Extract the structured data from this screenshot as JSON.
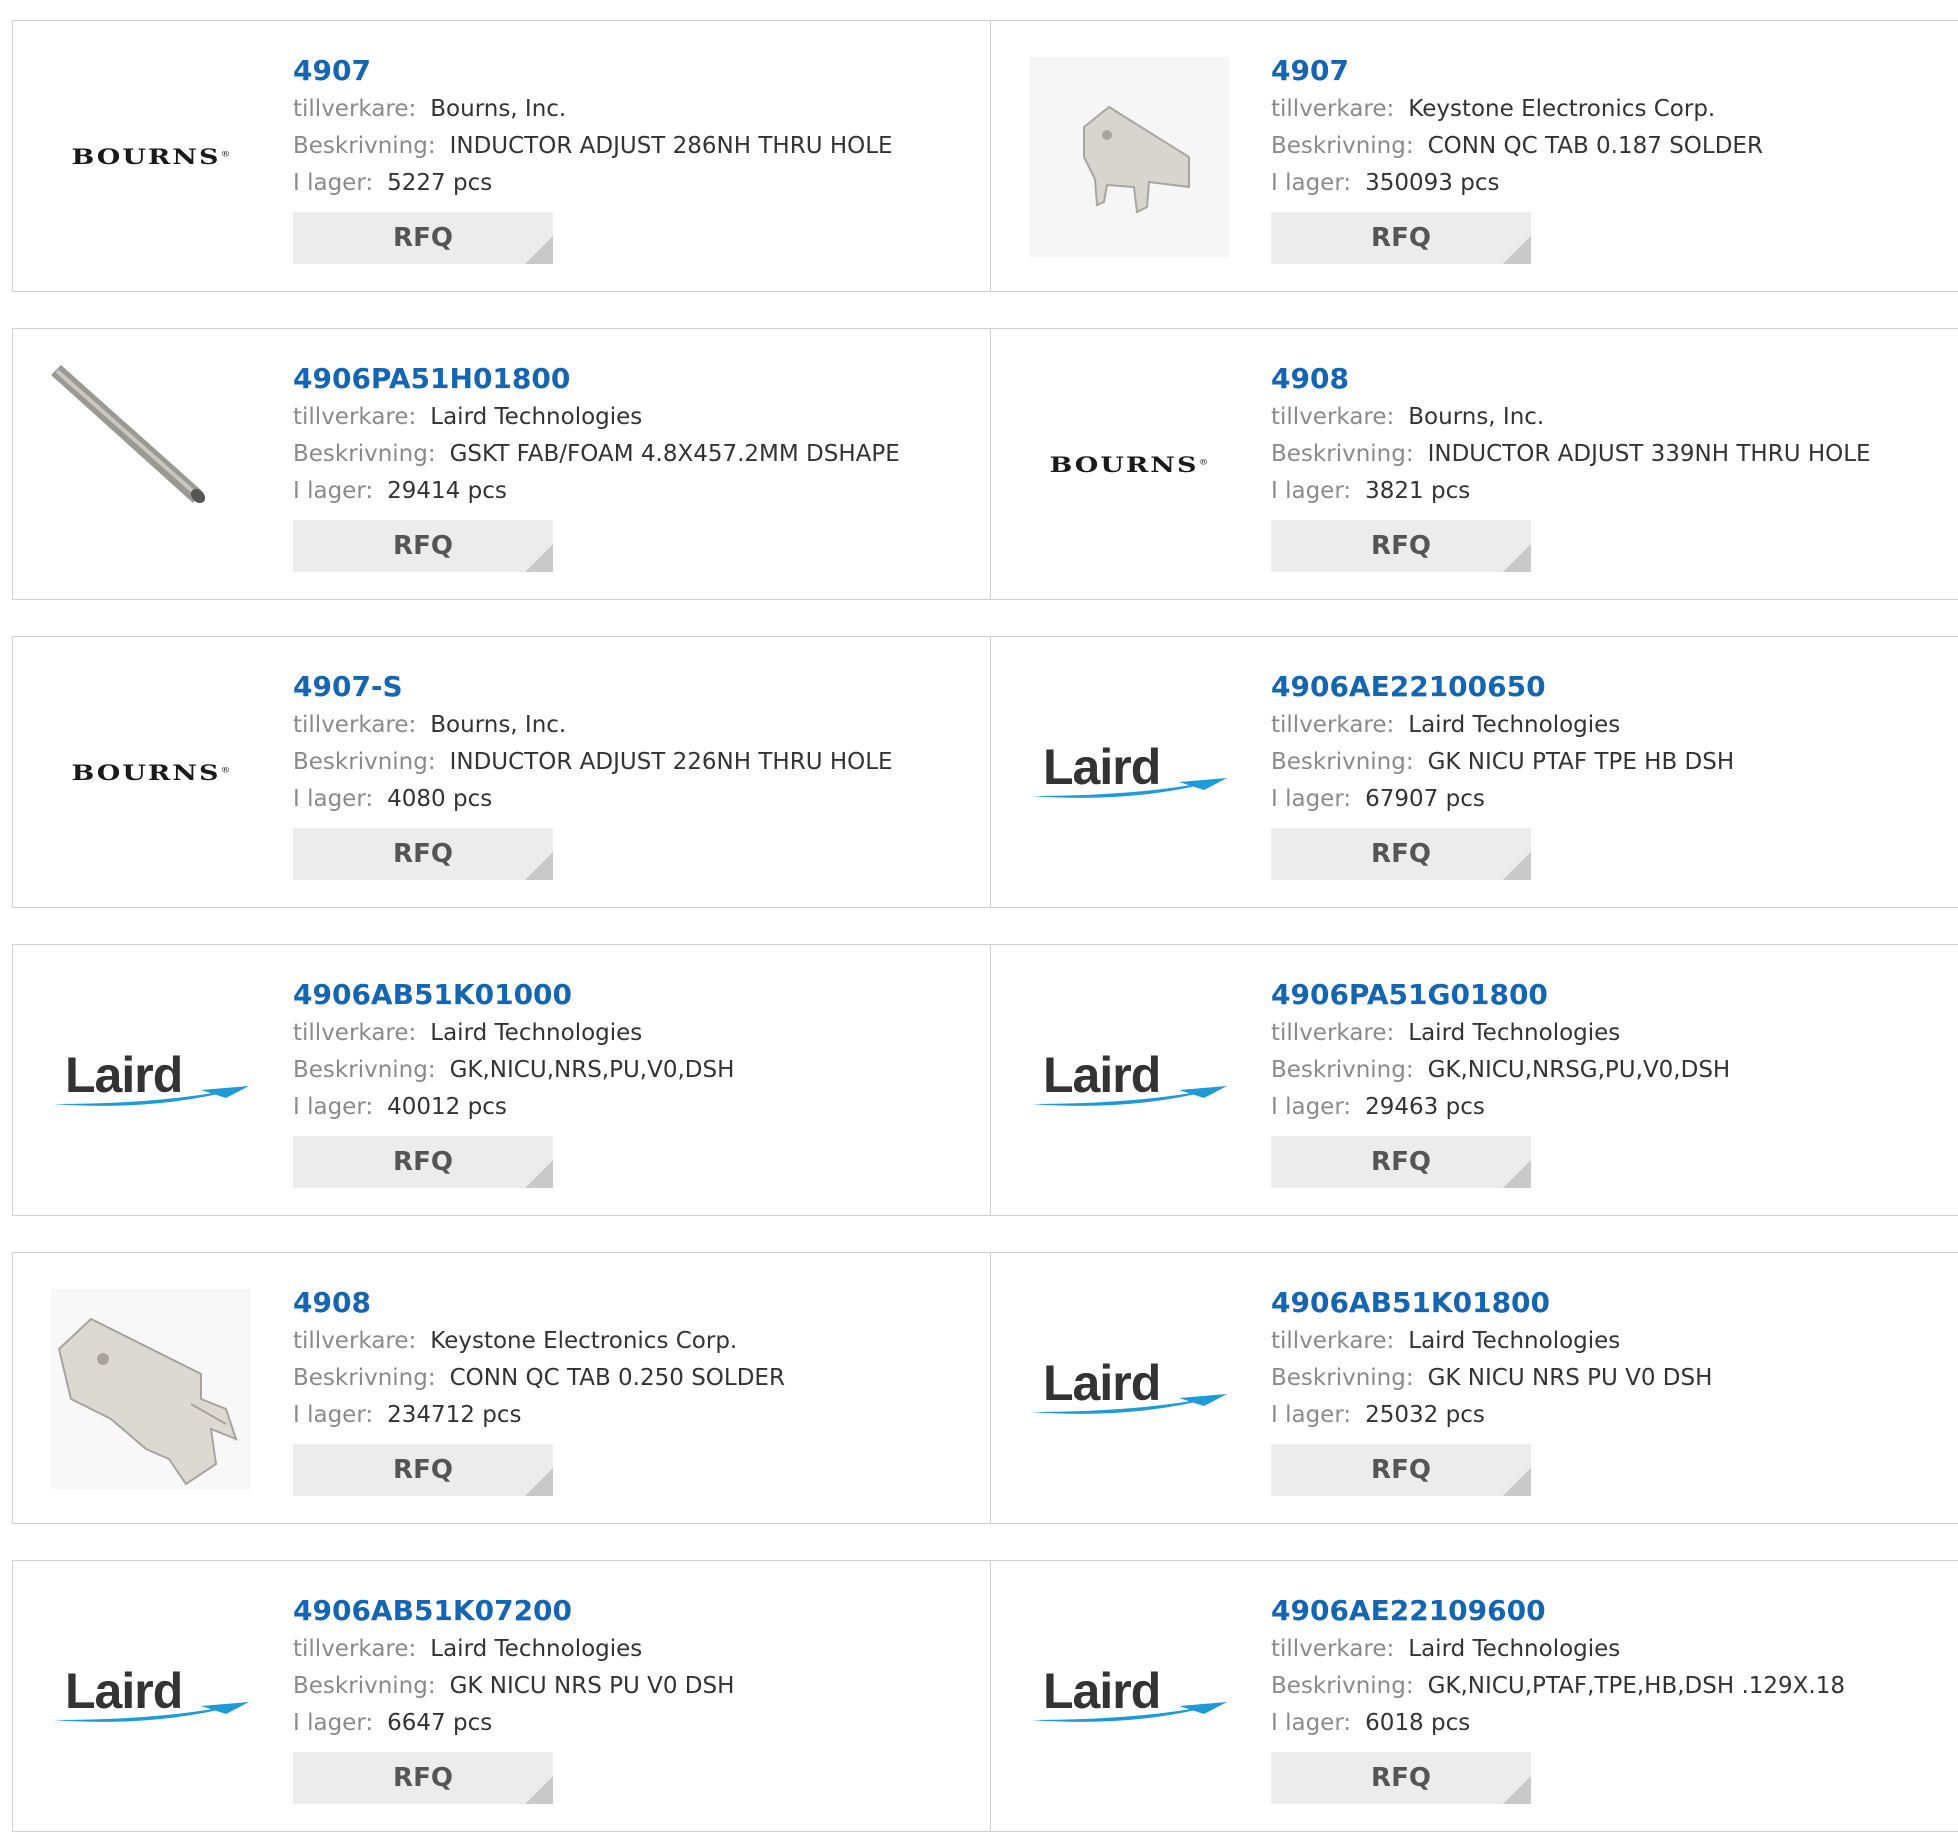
{
  "labels": {
    "manufacturer": "tillverkare:",
    "description": "Beskrivning:",
    "stock": "I lager:",
    "rfq": "RFQ"
  },
  "logos": {
    "bourns": "BOURNS",
    "laird": "Laird"
  },
  "products": [
    {
      "part": "4907",
      "manufacturer": "Bourns, Inc.",
      "description": "INDUCTOR ADJUST 286NH THRU HOLE",
      "stock": "5227 pcs",
      "image": "bourns-logo"
    },
    {
      "part": "4907",
      "manufacturer": "Keystone Electronics Corp.",
      "description": "CONN QC TAB 0.187 SOLDER",
      "stock": "350093 pcs",
      "image": "qc-tab-photo"
    },
    {
      "part": "4906PA51H01800",
      "manufacturer": "Laird Technologies",
      "description": "GSKT FAB/FOAM 4.8X457.2MM DSHAPE",
      "stock": "29414 pcs",
      "image": "gasket-photo"
    },
    {
      "part": "4908",
      "manufacturer": "Bourns, Inc.",
      "description": "INDUCTOR ADJUST 339NH THRU HOLE",
      "stock": "3821 pcs",
      "image": "bourns-logo"
    },
    {
      "part": "4907-S",
      "manufacturer": "Bourns, Inc.",
      "description": "INDUCTOR ADJUST 226NH THRU HOLE",
      "stock": "4080 pcs",
      "image": "bourns-logo"
    },
    {
      "part": "4906AE22100650",
      "manufacturer": "Laird Technologies",
      "description": "GK NICU PTAF TPE HB DSH",
      "stock": "67907 pcs",
      "image": "laird-logo"
    },
    {
      "part": "4906AB51K01000",
      "manufacturer": "Laird Technologies",
      "description": "GK,NICU,NRS,PU,V0,DSH",
      "stock": "40012 pcs",
      "image": "laird-logo"
    },
    {
      "part": "4906PA51G01800",
      "manufacturer": "Laird Technologies",
      "description": "GK,NICU,NRSG,PU,V0,DSH",
      "stock": "29463 pcs",
      "image": "laird-logo"
    },
    {
      "part": "4908",
      "manufacturer": "Keystone Electronics Corp.",
      "description": "CONN QC TAB 0.250 SOLDER",
      "stock": "234712 pcs",
      "image": "qc-tab-large-photo"
    },
    {
      "part": "4906AB51K01800",
      "manufacturer": "Laird Technologies",
      "description": "GK NICU NRS PU V0 DSH",
      "stock": "25032 pcs",
      "image": "laird-logo"
    },
    {
      "part": "4906AB51K07200",
      "manufacturer": "Laird Technologies",
      "description": "GK NICU NRS PU V0 DSH",
      "stock": "6647 pcs",
      "image": "laird-logo"
    },
    {
      "part": "4906AE22109600",
      "manufacturer": "Laird Technologies",
      "description": "GK,NICU,PTAF,TPE,HB,DSH .129X.18",
      "stock": "6018 pcs",
      "image": "laird-logo"
    }
  ]
}
